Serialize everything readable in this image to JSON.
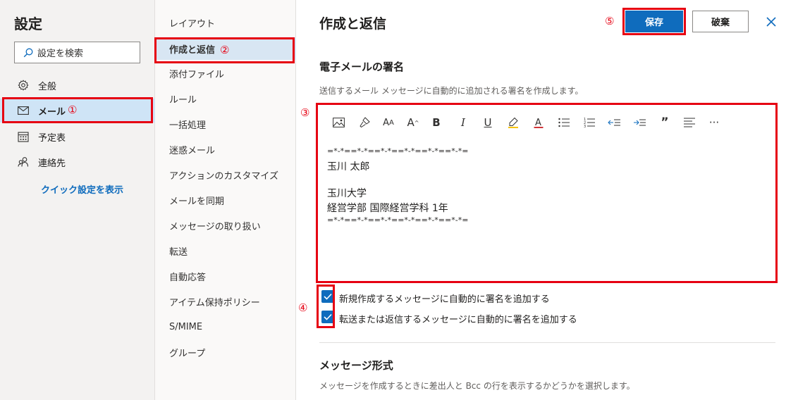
{
  "sidebar": {
    "title": "設定",
    "search_placeholder": "設定を検索",
    "items": [
      {
        "label": "全般",
        "icon": "gear-icon"
      },
      {
        "label": "メール",
        "icon": "mail-icon"
      },
      {
        "label": "予定表",
        "icon": "calendar-icon"
      },
      {
        "label": "連絡先",
        "icon": "people-icon"
      }
    ],
    "quick_link": "クイック設定を表示"
  },
  "subnav": {
    "items": [
      "レイアウト",
      "作成と返信",
      "添付ファイル",
      "ルール",
      "一括処理",
      "迷惑メール",
      "アクションのカスタマイズ",
      "メールを同期",
      "メッセージの取り扱い",
      "転送",
      "自動応答",
      "アイテム保持ポリシー",
      "S/MIME",
      "グループ"
    ]
  },
  "main": {
    "title": "作成と返信",
    "save_label": "保存",
    "discard_label": "破棄",
    "signature_section": {
      "title": "電子メールの署名",
      "description": "送信するメール メッセージに自動的に追加される署名を作成します。",
      "signature_lines": [
        "=*-*==*-*==*-*==*-*==*-*==*-*=",
        "玉川 太郎",
        "",
        "玉川大学",
        "経営学部 国際経営学科 1年",
        "=*-*==*-*==*-*==*-*==*-*==*-*="
      ],
      "checkboxes": [
        {
          "label": "新規作成するメッセージに自動的に署名を追加する",
          "checked": true
        },
        {
          "label": "転送または返信するメッセージに自動的に署名を追加する",
          "checked": true
        }
      ]
    },
    "format_section": {
      "title": "メッセージ形式",
      "description": "メッセージを作成するときに差出人と Bcc の行を表示するかどうかを選択します。"
    }
  },
  "annotations": {
    "n1": "①",
    "n2": "②",
    "n3": "③",
    "n4": "④",
    "n5": "⑤",
    "color": "#e60012"
  },
  "colors": {
    "accent": "#0f6cbd",
    "active_nav": "#cfe4f6"
  }
}
